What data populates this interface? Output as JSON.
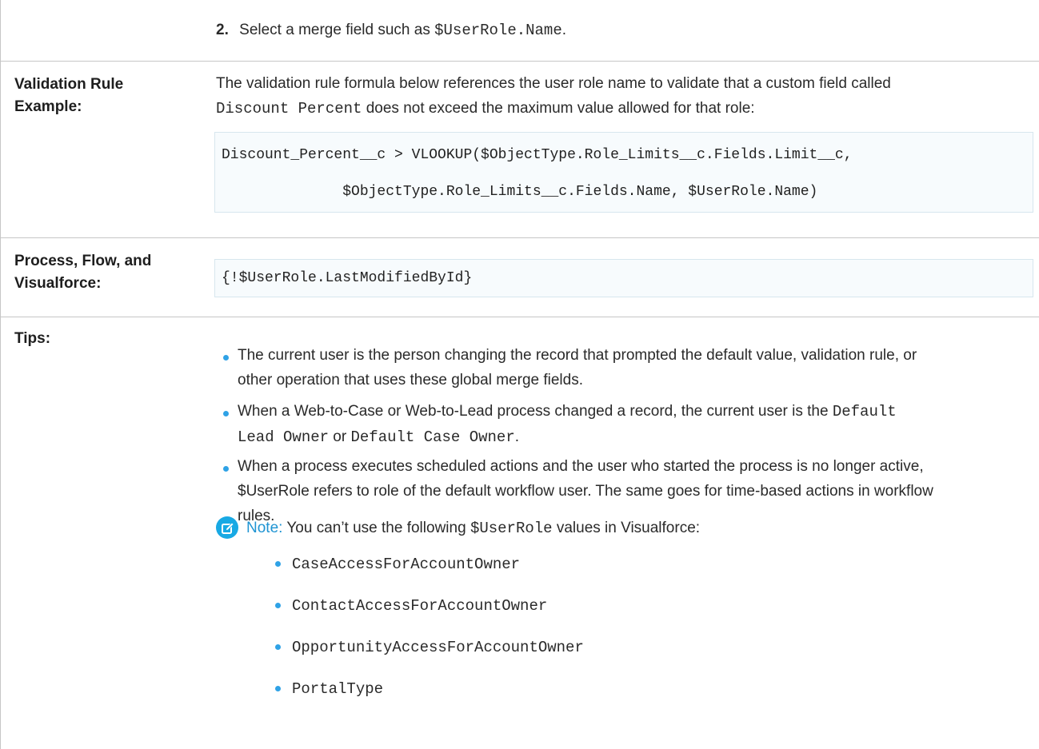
{
  "step": {
    "number": "2.",
    "text_before": "Select a merge field such as ",
    "code": "$UserRole.Name",
    "text_after": "."
  },
  "validation_rule": {
    "label_line1": "Validation Rule",
    "label_line2": "Example:",
    "desc_line1": "The validation rule formula below references the user role name to validate that a custom field called",
    "desc_code": "Discount Percent",
    "desc_line2_rest": " does not exceed the maximum value allowed for that role:",
    "code_line1": "Discount_Percent__c > VLOOKUP($ObjectType.Role_Limits__c.Fields.Limit__c,",
    "code_line2": "              $ObjectType.Role_Limits__c.Fields.Name, $UserRole.Name)"
  },
  "process": {
    "label_line1": "Process, Flow, and",
    "label_line2": "Visualforce:",
    "code": "{!$UserRole.LastModifiedById}"
  },
  "tips": {
    "label": "Tips:",
    "bullet1_line1": "The current user is the person changing the record that prompted the default value, validation rule, or",
    "bullet1_line2": "other operation that uses these global merge fields.",
    "bullet2_line1": "When a Web-to-Case or Web-to-Lead process changed a record, the current user is the ",
    "bullet2_code1": "Default",
    "bullet2_code2": "Lead Owner",
    "bullet2_or": " or ",
    "bullet2_code3": "Default Case Owner",
    "bullet2_end": ".",
    "bullet3_line1": "When a process executes scheduled actions and the user who started the process is no longer active,",
    "bullet3_line2": "$UserRole refers to role of the default workflow user. The same goes for time-based actions in workflow",
    "bullet3_line3": "rules.",
    "note_label": "Note:",
    "note_text_before": " You can’t use the following ",
    "note_code": "$UserRole",
    "note_text_after": " values in Visualforce:",
    "note_items": [
      "CaseAccessForAccountOwner",
      "ContactAccessForAccountOwner",
      "OpportunityAccessForAccountOwner",
      "PortalType"
    ]
  },
  "colors": {
    "accent": "#18a9e4",
    "rule": "#c6c6c6",
    "code_bg": "#f7fbfd"
  },
  "icons": {
    "note": "edit-note-icon"
  }
}
